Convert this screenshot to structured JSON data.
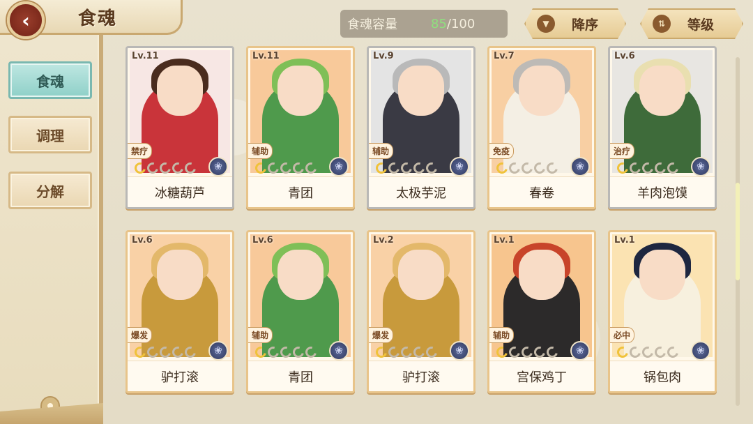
{
  "header": {
    "title": "食魂",
    "back_icon": "chevron-left-icon"
  },
  "sidebar": {
    "tabs": [
      {
        "label": "食魂",
        "active": true
      },
      {
        "label": "调理",
        "active": false
      },
      {
        "label": "分解",
        "active": false
      }
    ]
  },
  "capacity": {
    "label": "食魂容量",
    "current": "85",
    "max": "/100"
  },
  "sort": {
    "order_label": "降序",
    "order_icon": "triangle-down-icon",
    "criterion_label": "等级",
    "criterion_icon": "swap-icon"
  },
  "colors": {
    "accent_teal": "#8fd0c8",
    "capacity_current": "#8fe07e",
    "gold_border": "#e8c48a"
  },
  "cards": [
    {
      "level": "Lv.11",
      "role": "禁疗",
      "name": "冰糖葫芦",
      "stars_lit": 1,
      "stars_total": 5,
      "frame": "silver",
      "bg": "#f7e7e4",
      "hair": "#4a2c1e",
      "outfit": "#c9343a"
    },
    {
      "level": "Lv.11",
      "role": "辅助",
      "name": "青团",
      "stars_lit": 1,
      "stars_total": 5,
      "frame": "gold",
      "bg": "#f8c99a",
      "hair": "#7fbf57",
      "outfit": "#4f9a4c"
    },
    {
      "level": "Lv.9",
      "role": "辅助",
      "name": "太极芋泥",
      "stars_lit": 1,
      "stars_total": 5,
      "frame": "silver",
      "bg": "#e4e4e4",
      "hair": "#b9b9b9",
      "outfit": "#3a3a44"
    },
    {
      "level": "Lv.7",
      "role": "免疫",
      "name": "春卷",
      "stars_lit": 1,
      "stars_total": 5,
      "frame": "gold",
      "bg": "#f8cfa3",
      "hair": "#bdbab6",
      "outfit": "#f4efe4"
    },
    {
      "level": "Lv.6",
      "role": "治疗",
      "name": "羊肉泡馍",
      "stars_lit": 1,
      "stars_total": 5,
      "frame": "silver",
      "bg": "#e8e6e2",
      "hair": "#e9dfb0",
      "outfit": "#3e6b3a"
    },
    {
      "level": "Lv.6",
      "role": "爆发",
      "name": "驴打滚",
      "stars_lit": 1,
      "stars_total": 5,
      "frame": "gold",
      "bg": "#f9d1a6",
      "hair": "#e3b86a",
      "outfit": "#c89a3c"
    },
    {
      "level": "Lv.6",
      "role": "辅助",
      "name": "青团",
      "stars_lit": 1,
      "stars_total": 5,
      "frame": "gold",
      "bg": "#f8c99a",
      "hair": "#7fbf57",
      "outfit": "#4f9a4c"
    },
    {
      "level": "Lv.2",
      "role": "爆发",
      "name": "驴打滚",
      "stars_lit": 1,
      "stars_total": 5,
      "frame": "gold",
      "bg": "#f9d1a6",
      "hair": "#e3b86a",
      "outfit": "#c89a3c"
    },
    {
      "level": "Lv.1",
      "role": "辅助",
      "name": "宫保鸡丁",
      "stars_lit": 1,
      "stars_total": 5,
      "frame": "gold",
      "bg": "#f7c58e",
      "hair": "#c8442a",
      "outfit": "#2c2a2a"
    },
    {
      "level": "Lv.1",
      "role": "必中",
      "name": "锅包肉",
      "stars_lit": 1,
      "stars_total": 5,
      "frame": "gold",
      "bg": "#fbe3b2",
      "hair": "#1e2740",
      "outfit": "#f7f0de"
    }
  ]
}
